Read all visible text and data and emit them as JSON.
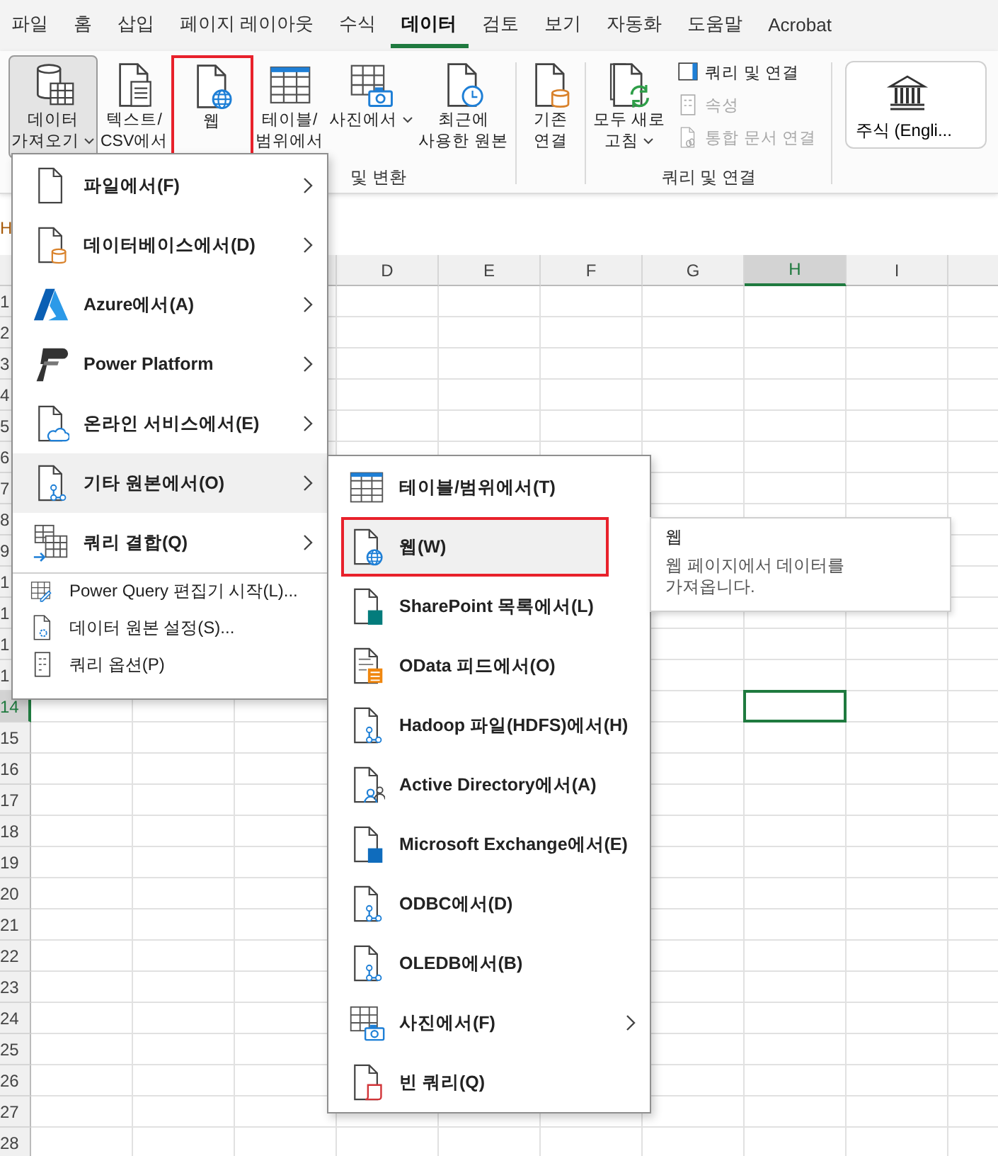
{
  "tabs": [
    {
      "label": "파일",
      "selected": false
    },
    {
      "label": "홈",
      "selected": false
    },
    {
      "label": "삽입",
      "selected": false
    },
    {
      "label": "페이지 레이아웃",
      "selected": false
    },
    {
      "label": "수식",
      "selected": false
    },
    {
      "label": "데이터",
      "selected": true
    },
    {
      "label": "검토",
      "selected": false
    },
    {
      "label": "보기",
      "selected": false
    },
    {
      "label": "자동화",
      "selected": false
    },
    {
      "label": "도움말",
      "selected": false
    },
    {
      "label": "Acrobat",
      "selected": false
    }
  ],
  "ribbon": {
    "groups": [
      {
        "label": "및 변환",
        "buttons": [
          {
            "label": "데이터\n가져오기",
            "dropdown": true,
            "pressed": true,
            "highlighted": false
          },
          {
            "label": "텍스트/\nCSV에서",
            "dropdown": false,
            "pressed": false,
            "highlighted": false
          },
          {
            "label": "웹",
            "dropdown": false,
            "pressed": false,
            "highlighted": true
          },
          {
            "label": "테이블/\n범위에서",
            "dropdown": false,
            "pressed": false,
            "highlighted": false
          },
          {
            "label": "사진에서",
            "dropdown": true,
            "pressed": false,
            "highlighted": false
          },
          {
            "label": "최근에\n사용한 원본",
            "dropdown": false,
            "pressed": false,
            "highlighted": false
          }
        ]
      },
      {
        "buttons": [
          {
            "label": "기존\n연결",
            "dropdown": false,
            "pressed": false,
            "highlighted": false
          }
        ]
      },
      {
        "label": "쿼리 및 연결",
        "buttons": [
          {
            "label": "모두 새로\n고침",
            "dropdown": true,
            "pressed": false,
            "highlighted": false
          }
        ],
        "small_buttons": [
          {
            "label": "쿼리 및 연결",
            "disabled": false
          },
          {
            "label": "속성",
            "disabled": true
          },
          {
            "label": "통합 문서 연결",
            "disabled": true
          }
        ]
      },
      {
        "gallery": {
          "label": "주식 (Engli..."
        }
      }
    ]
  },
  "name_box": {
    "value": "H"
  },
  "sheet": {
    "columns": [
      {
        "label": "D",
        "selected": false
      },
      {
        "label": "E",
        "selected": false
      },
      {
        "label": "F",
        "selected": false
      },
      {
        "label": "G",
        "selected": false
      },
      {
        "label": "H",
        "selected": true
      },
      {
        "label": "I",
        "selected": false
      }
    ],
    "rows": [
      {
        "label": "1",
        "selected": false
      },
      {
        "label": "2",
        "selected": false
      },
      {
        "label": "3",
        "selected": false
      },
      {
        "label": "4",
        "selected": false
      },
      {
        "label": "5",
        "selected": false
      },
      {
        "label": "6",
        "selected": false
      },
      {
        "label": "7",
        "selected": false
      },
      {
        "label": "8",
        "selected": false
      },
      {
        "label": "9",
        "selected": false
      },
      {
        "label": "1",
        "selected": false
      },
      {
        "label": "1",
        "selected": false
      },
      {
        "label": "1",
        "selected": false
      },
      {
        "label": "1",
        "selected": false
      },
      {
        "label": "14",
        "selected": true
      },
      {
        "label": "15",
        "selected": false
      },
      {
        "label": "16",
        "selected": false
      },
      {
        "label": "17",
        "selected": false
      },
      {
        "label": "18",
        "selected": false
      },
      {
        "label": "19",
        "selected": false
      },
      {
        "label": "20",
        "selected": false
      },
      {
        "label": "21",
        "selected": false
      },
      {
        "label": "22",
        "selected": false
      },
      {
        "label": "23",
        "selected": false
      },
      {
        "label": "24",
        "selected": false
      },
      {
        "label": "25",
        "selected": false
      },
      {
        "label": "26",
        "selected": false
      },
      {
        "label": "27",
        "selected": false
      },
      {
        "label": "28",
        "selected": false
      }
    ]
  },
  "get_data_menu": {
    "items": [
      {
        "label": "파일에서(F)",
        "kind": "large",
        "submenu": true,
        "hovered": false
      },
      {
        "label": "데이터베이스에서(D)",
        "kind": "large",
        "submenu": true,
        "hovered": false
      },
      {
        "label": "Azure에서(A)",
        "kind": "large",
        "submenu": true,
        "hovered": false
      },
      {
        "label": "Power Platform",
        "kind": "large",
        "submenu": true,
        "hovered": false
      },
      {
        "label": "온라인 서비스에서(E)",
        "kind": "large",
        "submenu": true,
        "hovered": false
      },
      {
        "label": "기타 원본에서(O)",
        "kind": "large",
        "submenu": true,
        "hovered": true
      },
      {
        "label": "쿼리 결합(Q)",
        "kind": "large",
        "submenu": true,
        "hovered": false
      },
      {
        "label": "Power Query 편집기 시작(L)...",
        "kind": "small",
        "submenu": false,
        "hovered": false
      },
      {
        "label": "데이터 원본 설정(S)...",
        "kind": "small",
        "submenu": false,
        "hovered": false
      },
      {
        "label": "쿼리 옵션(P)",
        "kind": "small",
        "submenu": false,
        "hovered": false
      }
    ]
  },
  "other_sources_menu": {
    "items": [
      {
        "label": "테이블/범위에서(T)",
        "submenu": false,
        "hovered": false,
        "highlighted": false
      },
      {
        "label": "웹(W)",
        "submenu": false,
        "hovered": true,
        "highlighted": true
      },
      {
        "label": "SharePoint 목록에서(L)",
        "submenu": false,
        "hovered": false,
        "highlighted": false
      },
      {
        "label": "OData 피드에서(O)",
        "submenu": false,
        "hovered": false,
        "highlighted": false
      },
      {
        "label": "Hadoop 파일(HDFS)에서(H)",
        "submenu": false,
        "hovered": false,
        "highlighted": false
      },
      {
        "label": "Active Directory에서(A)",
        "submenu": false,
        "hovered": false,
        "highlighted": false
      },
      {
        "label": "Microsoft Exchange에서(E)",
        "submenu": false,
        "hovered": false,
        "highlighted": false
      },
      {
        "label": "ODBC에서(D)",
        "submenu": false,
        "hovered": false,
        "highlighted": false
      },
      {
        "label": "OLEDB에서(B)",
        "submenu": false,
        "hovered": false,
        "highlighted": false
      },
      {
        "label": "사진에서(F)",
        "submenu": true,
        "hovered": false,
        "highlighted": false
      },
      {
        "label": "빈 쿼리(Q)",
        "submenu": false,
        "hovered": false,
        "highlighted": false
      }
    ]
  },
  "tooltip": {
    "title": "웹",
    "text": "웹 페이지에서 데이터를 가져옵니다."
  }
}
